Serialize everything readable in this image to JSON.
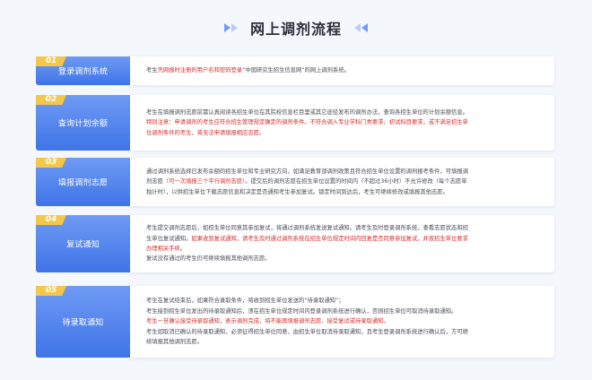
{
  "title": "网上调剂流程",
  "steps": [
    {
      "num": "01",
      "label": "登录调剂系统",
      "lines": [
        {
          "segments": [
            {
              "t": "考生",
              "red": false
            },
            {
              "t": "凭网报时注册的用户名和密码登录",
              "red": true
            },
            {
              "t": "“中国研究生招生信息网”的网上调剂系统。",
              "red": false
            }
          ]
        }
      ]
    },
    {
      "num": "02",
      "label": "查询计划余额",
      "lines": [
        {
          "segments": [
            {
              "t": "考生在填报调剂志愿前需认真阅读各招生单位在其院校信息栏目里或其它途径发布的调剂办法，查询各招生单位的计划余额信息。",
              "red": false
            }
          ]
        },
        {
          "segments": [
            {
              "t": "特别注意：申请调剂的考生应符合招生管理规定确定的调剂条件。不符合调入专业学科门类要求、初试科目要求，或不满足招生单",
              "red": true
            }
          ]
        },
        {
          "segments": [
            {
              "t": "位调剂条件的考生，将无法申请填报相应志愿。",
              "red": true
            }
          ]
        }
      ]
    },
    {
      "num": "03",
      "label": "填报调剂志愿",
      "lines": [
        {
          "segments": [
            {
              "t": "通过调剂系统选择已发布余额的招生单位和专业研究方向，如满足教育部调剂政策且符合招生单位设置的调剂报考条件，可填报调",
              "red": false
            }
          ]
        },
        {
          "segments": [
            {
              "t": "剂志愿",
              "red": false
            },
            {
              "t": "（可一次填报三个平行调剂志愿）",
              "red": true
            },
            {
              "t": "。提交后的调剂志愿在招生单位设置的时间内（不超过36小时）不允许修改（每个志愿单",
              "red": false
            }
          ]
        },
        {
          "segments": [
            {
              "t": "独计时），以供招生单位下载志愿信息和决定是否通知考生参加复试。锁定时间到达后，考生可继续修改或填报其他志愿。",
              "red": false
            }
          ]
        }
      ]
    },
    {
      "num": "04",
      "label": "复试通知",
      "lines": [
        {
          "segments": [
            {
              "t": "考生提交调剂志愿后，如招生单位同意其参加复试，将通过调剂系统发送复试通知。请考生及时登录调剂系统，查看志愿状态和招",
              "red": false
            }
          ]
        },
        {
          "segments": [
            {
              "t": "生单位复试通知。",
              "red": false
            },
            {
              "t": "如果收到复试通知，请考生及时通过调剂系统在招生单位规定时间内回复是否同意参加复试，并按招生单位要求",
              "red": true
            }
          ]
        },
        {
          "segments": [
            {
              "t": "办理相关手续。",
              "red": true
            }
          ]
        },
        {
          "segments": [
            {
              "t": "复试没有通过的考生仍可继续填报其他调剂志愿。",
              "red": false
            }
          ]
        }
      ]
    },
    {
      "num": "05",
      "label": "待录取通知",
      "lines": [
        {
          "segments": [
            {
              "t": "考生在复试结束后，如果符合录取条件，将收到招生单位发送的“待录取通知”；",
              "red": false
            }
          ]
        },
        {
          "segments": [
            {
              "t": "考生接到招生单位发出的待录取通知后，须在招生单位规定时间内登录调剂系统进行确认，否则招生单位可取消待录取通知。",
              "red": false
            }
          ]
        },
        {
          "segments": [
            {
              "t": "考生一旦确认接受待录取通知，表示调剂完成，将不能再填报调剂志愿、接受复试或待录取通知。",
              "red": true
            }
          ]
        },
        {
          "segments": [
            {
              "t": "考生如取消已确认的待录取通知，必须征得招生单位同意，由招生单位取消待录取通知，且考生登录调剂系统进行确认后，方可继",
              "red": false
            }
          ]
        },
        {
          "segments": [
            {
              "t": "续填报其他调剂志愿。",
              "red": false
            }
          ]
        }
      ]
    }
  ]
}
